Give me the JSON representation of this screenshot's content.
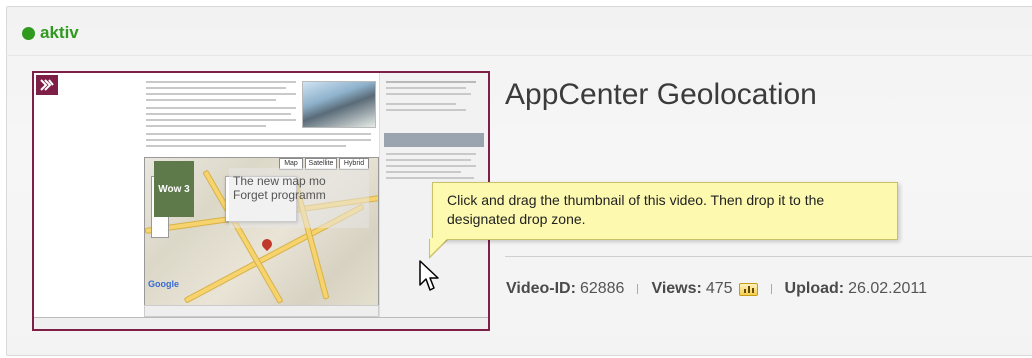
{
  "status": {
    "label": "aktiv",
    "color": "#2f9a1d"
  },
  "video": {
    "title": "AppCenter Geolocation",
    "thumbnail": {
      "map_buttons": [
        "Map",
        "Satellite",
        "Hybrid"
      ],
      "overlay_badge": "Wow 3",
      "overlay_text": "The new map mo\nForget programm",
      "map_brand": "Google",
      "border_color": "#7e1f47"
    },
    "meta": {
      "id_label": "Video-ID:",
      "id_value": "62886",
      "views_label": "Views:",
      "views_value": "475",
      "upload_label": "Upload:",
      "upload_value": "26.02.2011"
    }
  },
  "tooltip": {
    "text": "Click and drag the thumbnail of this video. Then drop it to the designated drop zone."
  },
  "icons": {
    "stats": "bar-chart-icon",
    "cursor": "mouse-pointer-icon",
    "badge": "video-badge-icon"
  }
}
